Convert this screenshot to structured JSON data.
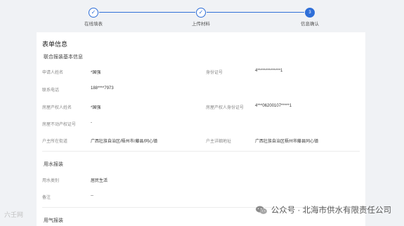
{
  "steps": [
    {
      "label": "在线填表",
      "icon": "✓"
    },
    {
      "label": "上传材料",
      "icon": "✓"
    },
    {
      "label": "信息确认",
      "number": "3"
    }
  ],
  "form": {
    "title": "表单信息",
    "basic_section": "联合报装基本信息",
    "fields": {
      "applicant_name": {
        "label": "申请人姓名",
        "value": "*国强"
      },
      "id_number": {
        "label": "身份证号",
        "value": "4**************1"
      },
      "phone": {
        "label": "联系电话",
        "value": "188****7973"
      },
      "owner_name": {
        "label": "房屋产权人姓名",
        "value": "*国强"
      },
      "owner_id": {
        "label": "房屋产权人身份证号",
        "value": "4***06200107*****1"
      },
      "property_cert": {
        "label": "房屋不动产权证号",
        "value": "-"
      },
      "street": {
        "label": "户主所在街道",
        "value": "广西壮族自治区/梧州市/藤县/同心镇"
      },
      "address": {
        "label": "户主详细地址",
        "value": "广西壮族自治区梧州市藤县同心镇"
      }
    },
    "water_section": "用水报装",
    "water_fields": {
      "water_type": {
        "label": "用水类别",
        "value": "居民生活"
      },
      "remark": {
        "label": "备注",
        "value": "--"
      }
    },
    "gas_section": "用气报装"
  },
  "watermark": {
    "text": "公众号 · 北海市供水有限责任公司",
    "icon": "wechat-icon"
  },
  "corner_logo": {
    "text": "六壬网"
  },
  "colors": {
    "accent": "#2f6fd8",
    "background": "#f0f2f5"
  }
}
